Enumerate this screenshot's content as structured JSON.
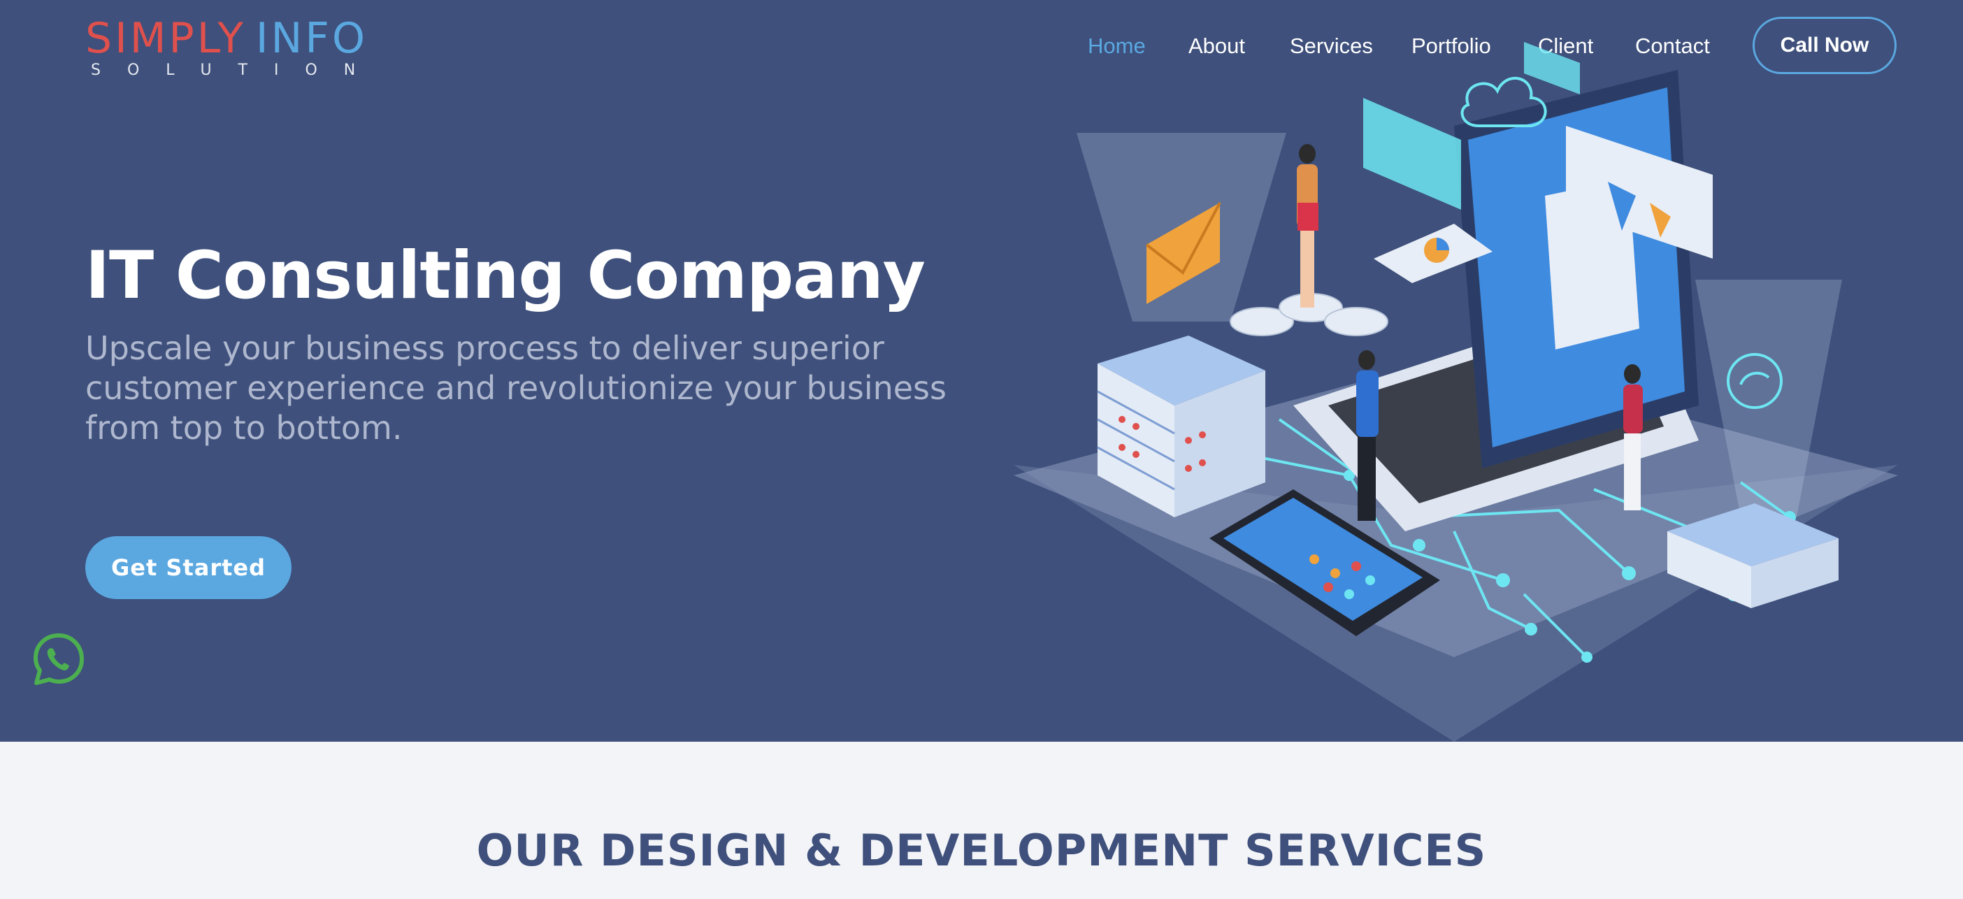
{
  "logo": {
    "word1": "SIMPLY",
    "word2": "INFO",
    "tagline": "SOLUTION"
  },
  "nav": {
    "items": [
      {
        "label": "Home",
        "active": true
      },
      {
        "label": "About"
      },
      {
        "label": "Services"
      },
      {
        "label": "Portfolio"
      },
      {
        "label": "Client"
      },
      {
        "label": "Contact"
      }
    ],
    "call_label": "Call Now"
  },
  "hero": {
    "title": "IT Consulting Company",
    "subtitle": "Upscale your business process to deliver superior customer experience and revolutionize your business from top to bottom.",
    "cta_label": "Get Started"
  },
  "services": {
    "title": "OUR DESIGN & DEVELOPMENT SERVICES"
  },
  "colors": {
    "hero_bg": "#3e507b",
    "accent": "#5ba8e1",
    "brand_red": "#e0504d",
    "whatsapp": "#4caf50",
    "section_bg": "#f3f4f8"
  },
  "icons": [
    "whatsapp-icon"
  ]
}
